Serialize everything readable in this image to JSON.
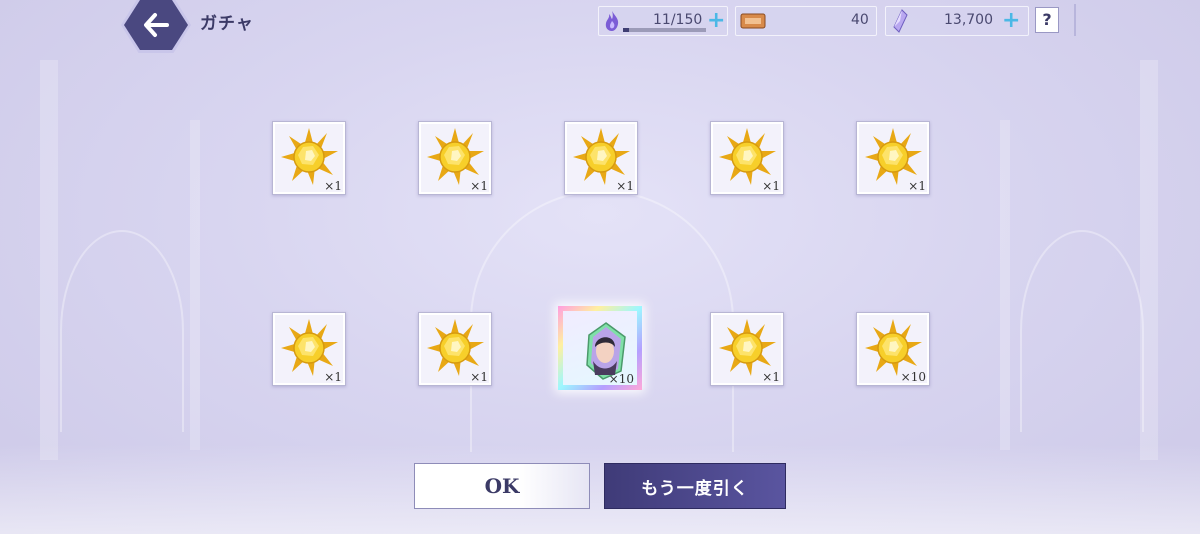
{
  "header": {
    "title": "ガチャ",
    "stamina": {
      "value": "11/150",
      "fill": 0.073
    },
    "tickets": {
      "value": "40"
    },
    "gems": {
      "value": "13,700"
    },
    "help_label": "?"
  },
  "results": [
    {
      "icon": "gold-crystal-icon",
      "qty": "×1"
    },
    {
      "icon": "gold-crystal-icon",
      "qty": "×1"
    },
    {
      "icon": "gold-crystal-icon",
      "qty": "×1"
    },
    {
      "icon": "gold-crystal-icon",
      "qty": "×1"
    },
    {
      "icon": "gold-crystal-icon",
      "qty": "×1"
    },
    {
      "icon": "gold-crystal-icon",
      "qty": "×1"
    },
    {
      "icon": "gold-crystal-icon",
      "qty": "×1"
    },
    {
      "icon": "character-crystal-icon",
      "qty": "×10"
    },
    {
      "icon": "gold-crystal-icon",
      "qty": "×1"
    },
    {
      "icon": "gold-crystal-icon",
      "qty": "×10"
    }
  ],
  "buttons": {
    "ok": "OK",
    "again": "もう一度引く"
  },
  "colors": {
    "accent": "#4a4880",
    "plus": "#4bb8e6",
    "gold": "#f2c31b"
  }
}
